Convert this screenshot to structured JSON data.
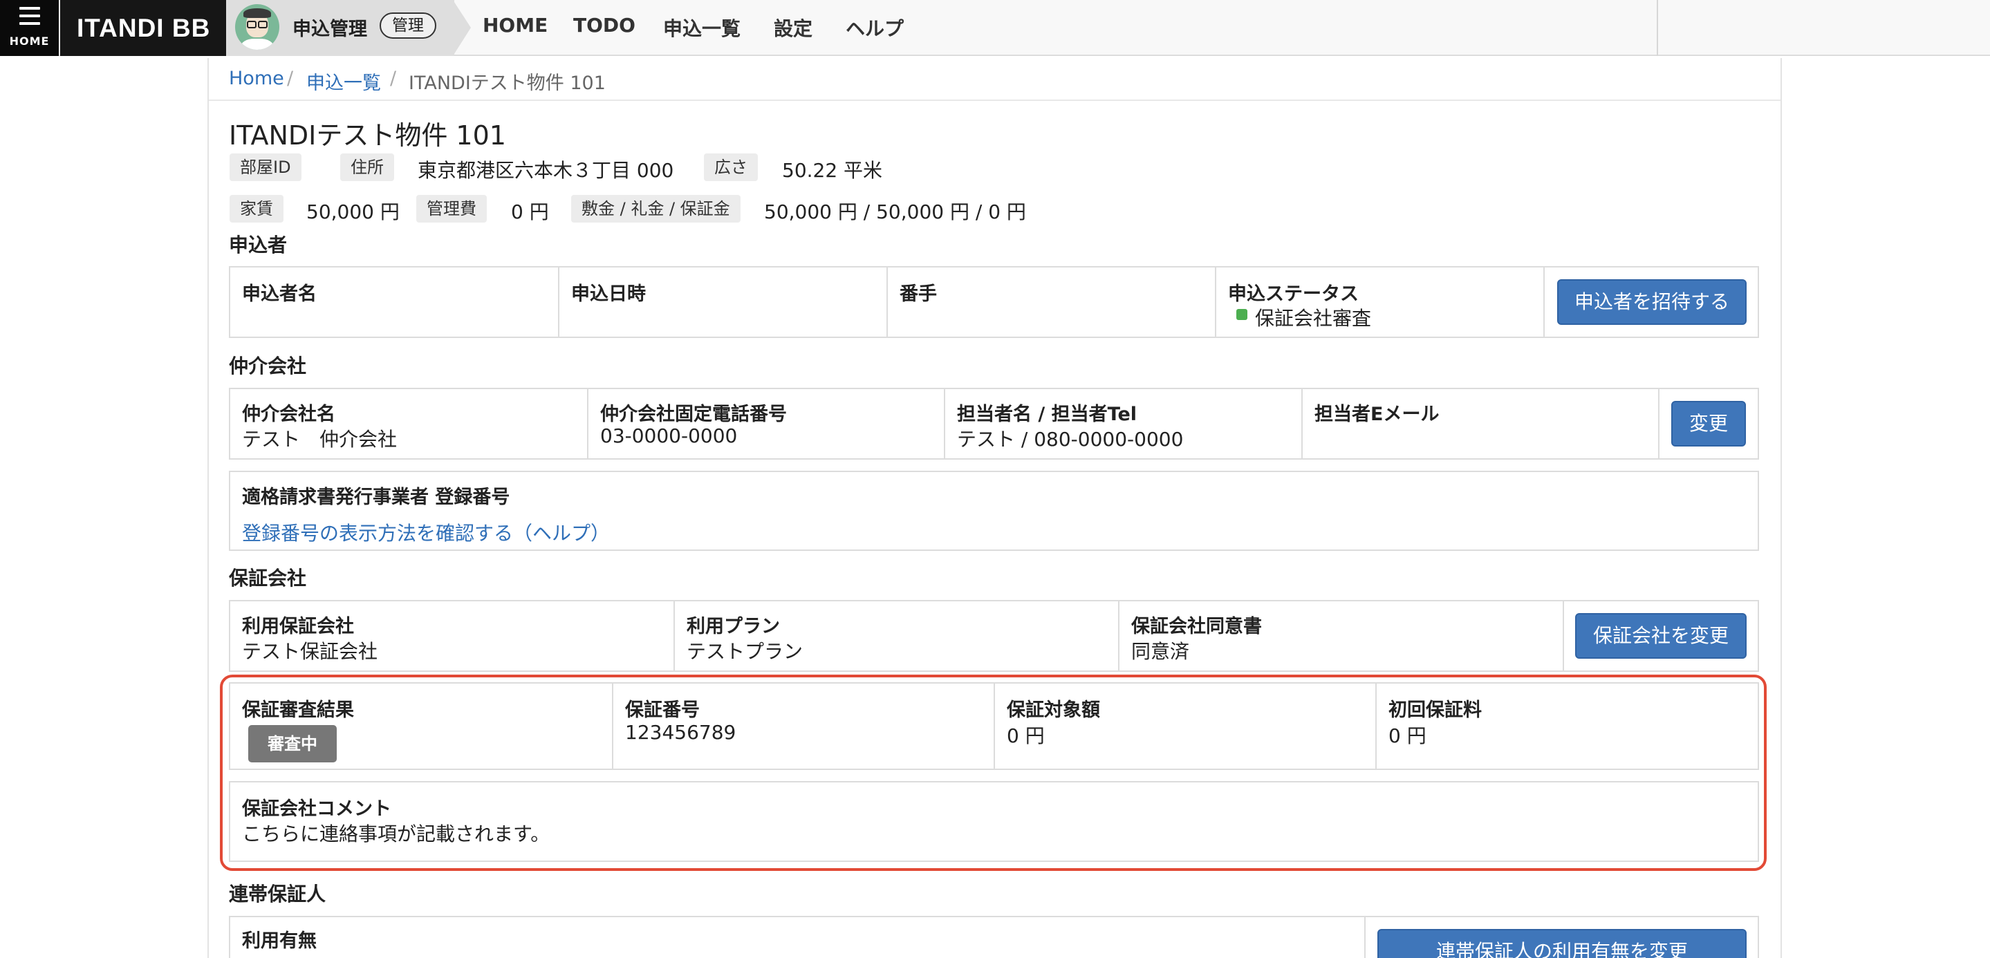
{
  "header": {
    "menu_label": "HOME",
    "brand": "ITANDI BB",
    "app_name": "申込管理",
    "app_badge": "管理",
    "nav": [
      "HOME",
      "TODO",
      "申込一覧",
      "設定",
      "ヘルプ"
    ]
  },
  "breadcrumb": {
    "home": "Home",
    "sep": "/",
    "list": "申込一覧",
    "current": "ITANDIテスト物件 101"
  },
  "property": {
    "title": "ITANDIテスト物件 101",
    "room_id_label": "部屋ID",
    "room_id_value": "",
    "address_label": "住所",
    "address_value": "東京都港区六本木３丁目 000",
    "area_label": "広さ",
    "area_value": "50.22 平米",
    "rent_label": "家賃",
    "rent_value": "50,000 円",
    "mgmt_label": "管理費",
    "mgmt_value": "0 円",
    "deposit_label": "敷金 / 礼金 / 保証金",
    "deposit_value": "50,000 円 / 50,000 円 / 0 円"
  },
  "applicant": {
    "section": "申込者",
    "name_label": "申込者名",
    "name_value": "",
    "date_label": "申込日時",
    "date_value": "",
    "order_label": "番手",
    "order_value": "",
    "status_label": "申込ステータス",
    "status_value": "保証会社審査",
    "status_color": "#4caf50",
    "invite_button": "申込者を招待する"
  },
  "broker": {
    "section": "仲介会社",
    "name_label": "仲介会社名",
    "name_value": "テスト　仲介会社",
    "phone_label": "仲介会社固定電話番号",
    "phone_value": "03-0000-0000",
    "staff_label": "担当者名 / 担当者Tel",
    "staff_value": "テスト / 080-0000-0000",
    "email_label": "担当者Eメール",
    "email_value": "",
    "change_button": "変更",
    "invoice_label": "適格請求書発行事業者 登録番号",
    "invoice_help_link": "登録番号の表示方法を確認する（ヘルプ）"
  },
  "guarantor_company": {
    "section": "保証会社",
    "company_label": "利用保証会社",
    "company_value": "テスト保証会社",
    "plan_label": "利用プラン",
    "plan_value": "テストプラン",
    "consent_label": "保証会社同意書",
    "consent_value": "同意済",
    "change_button": "保証会社を変更",
    "result_label": "保証審査結果",
    "result_badge": "審査中",
    "number_label": "保証番号",
    "number_value": "123456789",
    "amount_label": "保証対象額",
    "amount_value": "0 円",
    "fee_label": "初回保証料",
    "fee_value": "0 円",
    "comment_label": "保証会社コメント",
    "comment_value": "こちらに連絡事項が記載されます。",
    "highlight_color": "#e24a36"
  },
  "joint_guarantor": {
    "section": "連帯保証人",
    "usage_label": "利用有無",
    "change_button": "連帯保証人の利用有無を変更"
  },
  "colors": {
    "primary_button": "#3f76ba",
    "link": "#2f6fb8"
  }
}
